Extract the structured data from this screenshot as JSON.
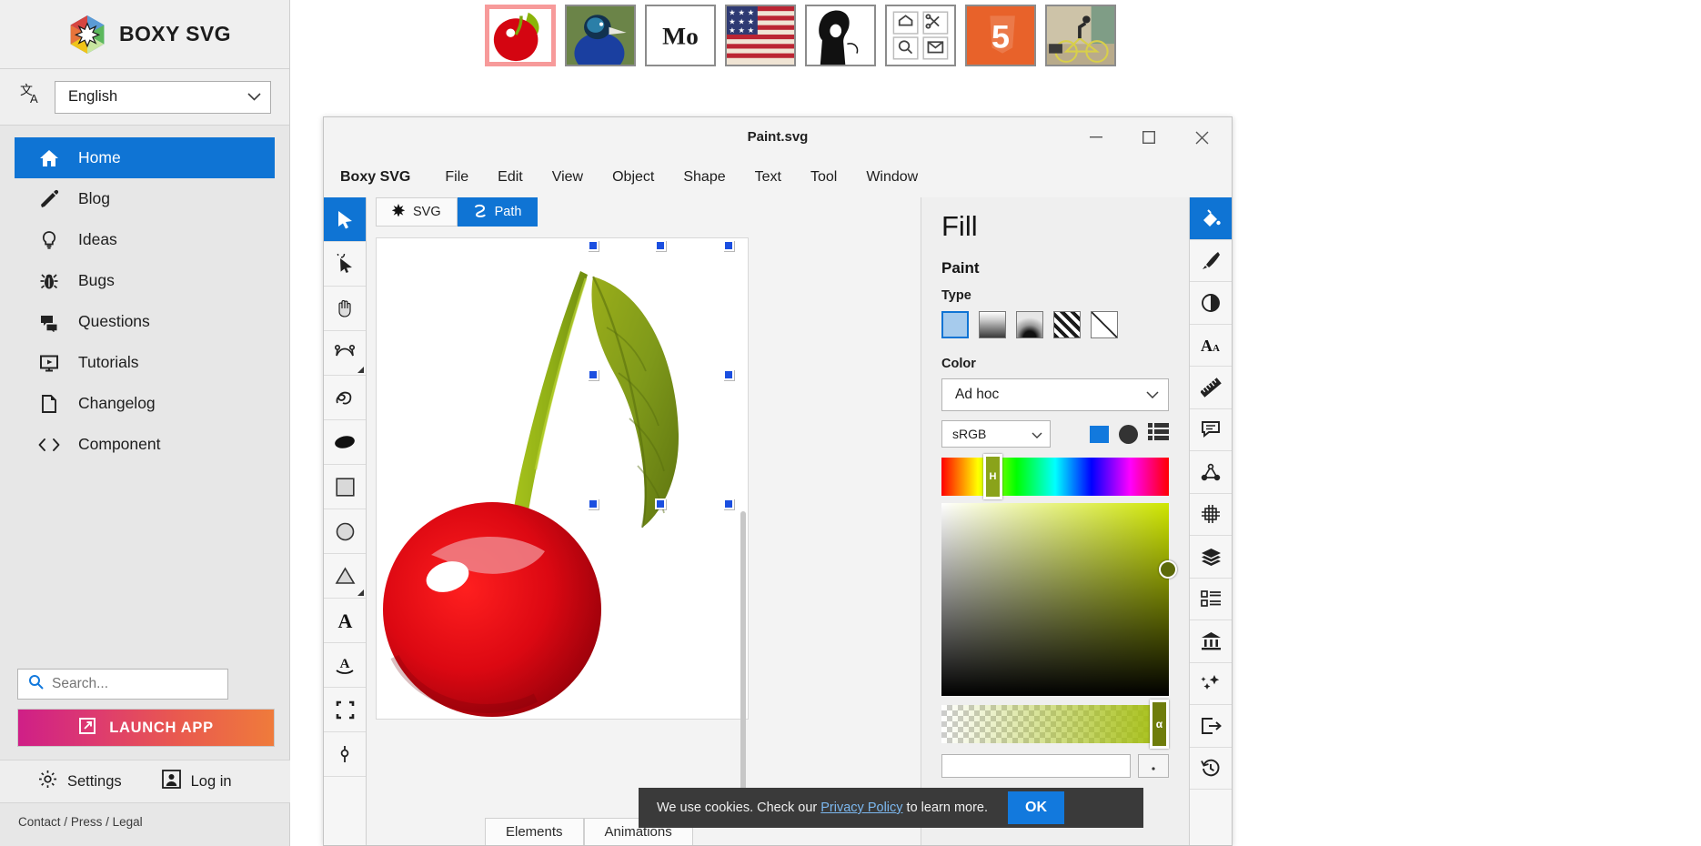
{
  "sidebar": {
    "brand": "BOXY SVG",
    "logo_icon": "boxy-svg-logo",
    "language": {
      "icon": "translate-icon",
      "value": "English",
      "chevron": "chevron-down-icon"
    },
    "nav_items": [
      {
        "label": "Home",
        "icon": "home-icon",
        "active": true
      },
      {
        "label": "Blog",
        "icon": "pencil-icon",
        "active": false
      },
      {
        "label": "Ideas",
        "icon": "lightbulb-icon",
        "active": false
      },
      {
        "label": "Bugs",
        "icon": "bug-icon",
        "active": false
      },
      {
        "label": "Questions",
        "icon": "chat-icon",
        "active": false
      },
      {
        "label": "Tutorials",
        "icon": "video-icon",
        "active": false
      },
      {
        "label": "Changelog",
        "icon": "document-icon",
        "active": false
      },
      {
        "label": "Component",
        "icon": "code-icon",
        "active": false
      }
    ],
    "search": {
      "icon": "search-icon",
      "placeholder": "Search...",
      "value": ""
    },
    "launch_button": {
      "label": "LAUNCH APP",
      "icon": "external-link-icon"
    },
    "footer_actions": [
      {
        "label": "Settings",
        "icon": "gear-icon"
      },
      {
        "label": "Log in",
        "icon": "user-avatar-icon"
      }
    ],
    "legal_links": [
      "Contact",
      "Press",
      "Legal"
    ],
    "legal_separator": "/"
  },
  "thumbnails": [
    {
      "name": "cherry-thumbnail",
      "selected": true
    },
    {
      "name": "peacock-thumbnail",
      "selected": false
    },
    {
      "name": "mo-text-thumbnail",
      "selected": false
    },
    {
      "name": "usa-flag-thumbnail",
      "selected": false
    },
    {
      "name": "portrait-thumbnail",
      "selected": false
    },
    {
      "name": "icon-grid-thumbnail",
      "selected": false
    },
    {
      "name": "html5-logo-thumbnail",
      "selected": false
    },
    {
      "name": "cyclist-thumbnail",
      "selected": false
    }
  ],
  "app_window": {
    "title": "Paint.svg",
    "window_controls": [
      {
        "name": "minimize-button",
        "glyph": "–"
      },
      {
        "name": "maximize-button",
        "glyph": "☐"
      },
      {
        "name": "close-button",
        "glyph": "✕"
      }
    ],
    "menus": [
      "Boxy SVG",
      "File",
      "Edit",
      "View",
      "Object",
      "Shape",
      "Text",
      "Tool",
      "Window"
    ],
    "left_tools": [
      {
        "name": "select-tool",
        "icon": "cursor-arrow-icon",
        "active": true
      },
      {
        "name": "node-edit-tool",
        "icon": "node-cursor-icon",
        "active": false
      },
      {
        "name": "pan-tool",
        "icon": "hand-icon",
        "active": false
      },
      {
        "name": "bezier-tool",
        "icon": "bezier-curve-icon",
        "active": false
      },
      {
        "name": "freehand-tool",
        "icon": "freehand-squiggle-icon",
        "active": false
      },
      {
        "name": "blob-tool",
        "icon": "filled-ellipse-icon",
        "active": false
      },
      {
        "name": "rectangle-tool",
        "icon": "rectangle-icon",
        "active": false
      },
      {
        "name": "ellipse-tool",
        "icon": "circle-icon",
        "active": false
      },
      {
        "name": "polygon-tool",
        "icon": "triangle-icon",
        "active": false
      },
      {
        "name": "text-tool",
        "icon": "letter-a-icon",
        "active": false
      },
      {
        "name": "text-on-path-tool",
        "icon": "text-on-path-icon",
        "active": false
      },
      {
        "name": "crop-tool",
        "icon": "crop-frame-icon",
        "active": false
      },
      {
        "name": "point-tool",
        "icon": "anchor-point-icon",
        "active": false
      }
    ],
    "canvas_tabs": [
      {
        "label": "SVG",
        "icon": "asterisk-icon",
        "active": false
      },
      {
        "label": "Path",
        "icon": "path-curve-icon",
        "active": true
      }
    ],
    "artwork": {
      "name": "cherry-artwork",
      "selection_handles": 8
    },
    "bottom_tabs": [
      {
        "label": "Elements",
        "active": true
      },
      {
        "label": "Animations",
        "active": false
      }
    ],
    "fill_panel": {
      "title": "Fill",
      "paint_label": "Paint",
      "type_label": "Type",
      "types": [
        {
          "name": "solid-fill-swatch",
          "selected": true
        },
        {
          "name": "linear-gradient-swatch",
          "selected": false
        },
        {
          "name": "radial-gradient-swatch",
          "selected": false
        },
        {
          "name": "pattern-fill-swatch",
          "selected": false
        },
        {
          "name": "none-fill-swatch",
          "selected": false
        }
      ],
      "color_label": "Color",
      "color_preset": "Ad hoc",
      "color_space": "sRGB",
      "mode_icons": [
        {
          "name": "swatch-color-icon",
          "color": "#1279dd"
        },
        {
          "name": "color-wheel-icon",
          "color": "#333333"
        },
        {
          "name": "sliders-list-icon",
          "color": "#333333"
        }
      ],
      "hue_handle_label": "H",
      "alpha_handle_label": "α",
      "chevron": "chevron-down-icon"
    },
    "right_rail": [
      {
        "name": "fill-panel-icon",
        "icon": "paint-bucket-icon",
        "active": true
      },
      {
        "name": "stroke-panel-icon",
        "icon": "brush-icon",
        "active": false
      },
      {
        "name": "filters-panel-icon",
        "icon": "contrast-circle-icon",
        "active": false
      },
      {
        "name": "typography-panel-icon",
        "icon": "letters-aa-icon",
        "active": false
      },
      {
        "name": "geometry-panel-icon",
        "icon": "ruler-icon",
        "active": false
      },
      {
        "name": "comments-panel-icon",
        "icon": "speech-bubble-icon",
        "active": false
      },
      {
        "name": "nodes-panel-icon",
        "icon": "path-nodes-icon",
        "active": false
      },
      {
        "name": "grid-panel-icon",
        "icon": "grid-icon",
        "active": false
      },
      {
        "name": "layers-panel-icon",
        "icon": "layers-stack-icon",
        "active": false
      },
      {
        "name": "elements-panel-icon",
        "icon": "list-panel-icon",
        "active": false
      },
      {
        "name": "library-panel-icon",
        "icon": "museum-bank-icon",
        "active": false
      },
      {
        "name": "effects-panel-icon",
        "icon": "sparkle-gear-icon",
        "active": false
      },
      {
        "name": "export-panel-icon",
        "icon": "export-arrow-icon",
        "active": false
      },
      {
        "name": "history-panel-icon",
        "icon": "clock-history-icon",
        "active": false
      }
    ]
  },
  "cookie_banner": {
    "text_before": "We use cookies. Check our",
    "link": "Privacy Policy",
    "text_after": "to learn more.",
    "ok_label": "OK"
  },
  "colors": {
    "accent_blue": "#0f74d4",
    "selection_blue": "#1b4fe0",
    "sidebar_bg": "#e7e7e7",
    "cookie_bg": "#3a3a3a",
    "thumb_selected_border": "#f79a9a",
    "picker_green": "#a3bd0e"
  }
}
